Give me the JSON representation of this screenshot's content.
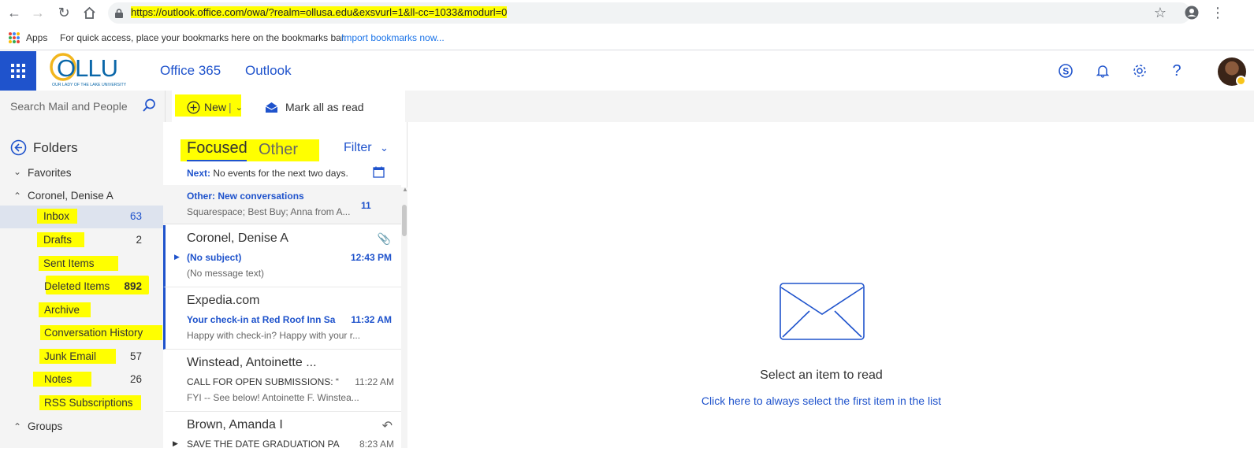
{
  "browser": {
    "url": "https://outlook.office.com/owa/?realm=ollusa.edu&exsvurl=1&ll-cc=1033&modurl=0",
    "bookmarks": {
      "apps_label": "Apps",
      "hint": "For quick access, place your bookmarks here on the bookmarks bar.",
      "import_link": "Import bookmarks now..."
    }
  },
  "header": {
    "logo_text": "OLLU",
    "logo_subtext": "OUR LADY OF THE LAKE UNIVERSITY",
    "app_links": [
      "Office 365",
      "Outlook"
    ],
    "icons": [
      "skype-icon",
      "bell-icon",
      "gear-icon",
      "help-icon"
    ]
  },
  "command_bar": {
    "search_placeholder": "Search Mail and People",
    "new_label": "New",
    "new_separator": "|",
    "mark_all_label": "Mark all as read"
  },
  "folders": {
    "title": "Folders",
    "favorites_label": "Favorites",
    "account_label": "Coronel, Denise A",
    "items": [
      {
        "label": "Inbox",
        "count": "63"
      },
      {
        "label": "Drafts",
        "count": "2"
      },
      {
        "label": "Sent Items",
        "count": ""
      },
      {
        "label": "Deleted Items",
        "count": "892"
      },
      {
        "label": "Archive",
        "count": ""
      },
      {
        "label": "Conversation History",
        "count": ""
      },
      {
        "label": "Junk Email",
        "count": "57"
      },
      {
        "label": "Notes",
        "count": "26"
      },
      {
        "label": "RSS Subscriptions",
        "count": ""
      }
    ],
    "groups_label": "Groups"
  },
  "message_list": {
    "tabs": [
      "Focused",
      "Other"
    ],
    "filter_label": "Filter",
    "next_label": "Next:",
    "next_text": "No events for the next two days.",
    "other_banner": {
      "title": "Other: New conversations",
      "senders": "Squarespace; Best Buy; Anna from A...",
      "count": "11"
    },
    "messages": [
      {
        "from": "Coronel, Denise A",
        "subject": "(No subject)",
        "time": "12:43 PM",
        "preview": "(No message text)",
        "unread": true
      },
      {
        "from": "Expedia.com",
        "subject": "Your check-in at Red Roof Inn Sa",
        "time": "11:32 AM",
        "preview": "Happy with check-in? Happy with your r...",
        "unread": true
      },
      {
        "from": "Winstead, Antoinette ...",
        "subject": "CALL FOR OPEN SUBMISSIONS: “",
        "time": "11:22 AM",
        "preview": "FYI -- See below! Antoinette F. Winstea...",
        "unread": false
      },
      {
        "from": "Brown, Amanda I",
        "subject": "SAVE THE DATE GRADUATION PA",
        "time": "8:23 AM",
        "preview": "",
        "unread": false
      }
    ]
  },
  "reading_pane": {
    "empty_title": "Select an item to read",
    "first_item_link": "Click here to always select the first item in the list"
  },
  "colors": {
    "accent": "#1f53cc",
    "highlight": "#ffff00",
    "pane_bg": "#f4f4f4"
  }
}
